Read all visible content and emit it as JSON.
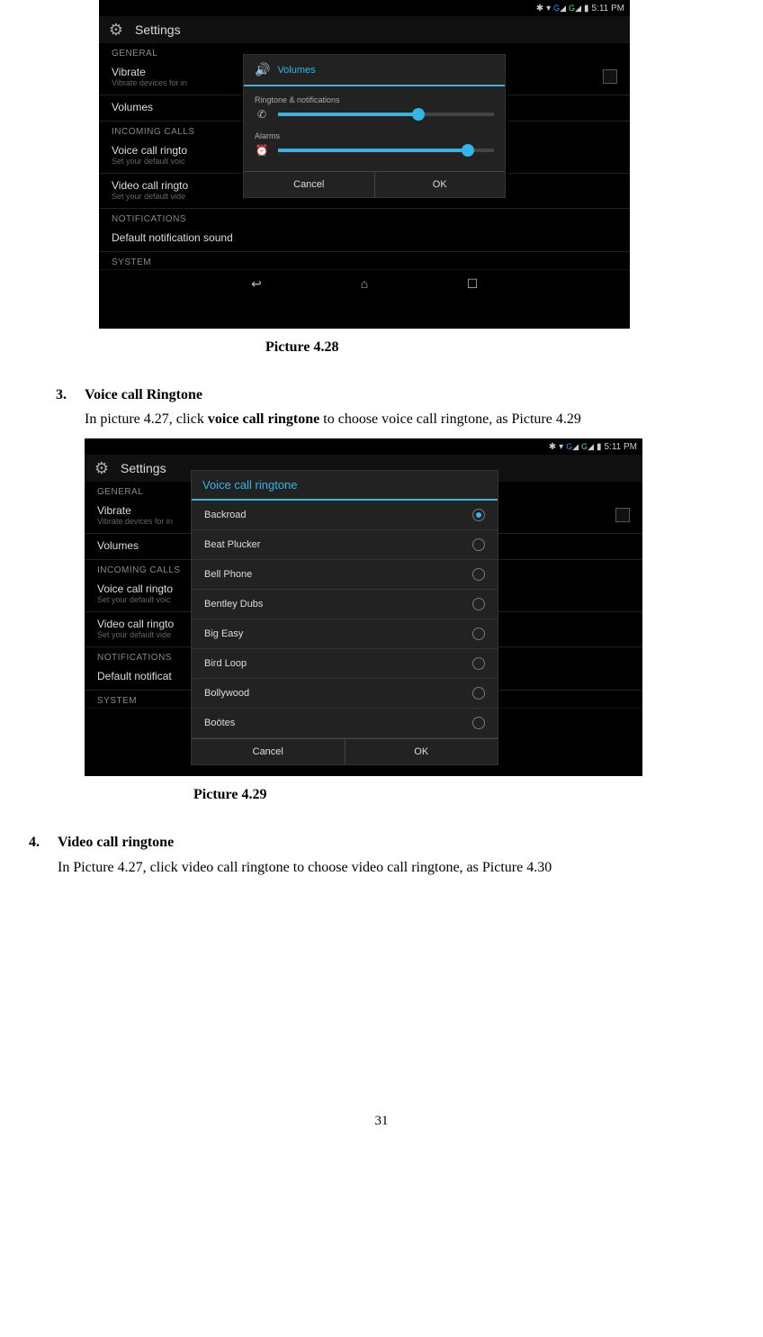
{
  "statusbar": {
    "bt": "✱",
    "wifi": "▾",
    "g1": "G",
    "sig1": "◢",
    "g2": "G",
    "sig2": "◢",
    "batt": "▮",
    "time": "5:11 PM"
  },
  "settings": {
    "title": "Settings",
    "sections": {
      "general": "GENERAL",
      "incoming": "INCOMING CALLS",
      "notifications": "NOTIFICATIONS",
      "system": "SYSTEM"
    },
    "rows": {
      "vibrate": "Vibrate",
      "vibrate_sub_cut": "Vibrate devices for in",
      "volumes": "Volumes",
      "voice_ring": "Voice call ringto",
      "voice_ring_sub": "Set your default voic",
      "video_ring": "Video call ringto",
      "video_ring_sub": "Set your default vide",
      "default_notif": "Default notification sound",
      "default_notif_cut": "Default notificat"
    }
  },
  "volumes_dialog": {
    "title": "Volumes",
    "ringtone_label": "Ringtone & notifications",
    "alarms_label": "Alarms",
    "cancel": "Cancel",
    "ok": "OK"
  },
  "ringtone_dialog": {
    "title": "Voice call ringtone",
    "items": [
      {
        "label": "Backroad",
        "selected": true
      },
      {
        "label": "Beat Plucker",
        "selected": false
      },
      {
        "label": "Bell Phone",
        "selected": false
      },
      {
        "label": "Bentley Dubs",
        "selected": false
      },
      {
        "label": "Big Easy",
        "selected": false
      },
      {
        "label": "Bird Loop",
        "selected": false
      },
      {
        "label": "Bollywood",
        "selected": false
      },
      {
        "label": "Boötes",
        "selected": false
      }
    ],
    "cancel": "Cancel",
    "ok": "OK"
  },
  "doc": {
    "caption428": "Picture 4.28",
    "caption429": "Picture 4.29",
    "item3_num": "3.",
    "item3_heading": "Voice call Ringtone",
    "item3_body_a": "In picture 4.27, click ",
    "item3_body_bold": "voice call ringtone",
    "item3_body_b": " to choose voice call ringtone, as Picture 4.29",
    "item4_num": "4.",
    "item4_heading": "Video call ringtone",
    "item4_body": "In Picture 4.27, click video call ringtone to choose video call ringtone, as Picture 4.30",
    "page_number": "31"
  }
}
